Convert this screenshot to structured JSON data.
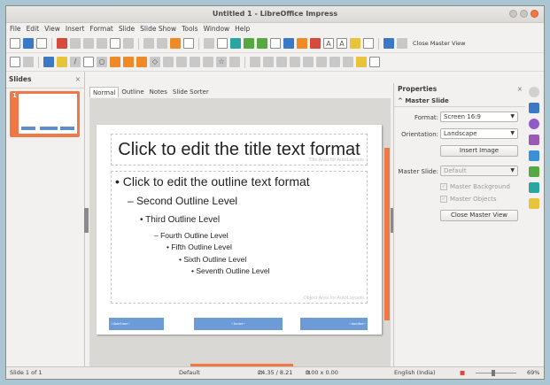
{
  "window": {
    "title": "Untitled 1 - LibreOffice Impress"
  },
  "menu": [
    "File",
    "Edit",
    "View",
    "Insert",
    "Format",
    "Slide",
    "Slide Show",
    "Tools",
    "Window",
    "Help"
  ],
  "toolbar": {
    "close_master_view": "Close Master View"
  },
  "slides_pane": {
    "title": "Slides",
    "close": "×",
    "thumb_number": "1"
  },
  "tabs": [
    "Normal",
    "Outline",
    "Notes",
    "Slide Sorter"
  ],
  "slide": {
    "title": "Click to edit the title text format",
    "title_area_label": "Title Area for AutoLayouts",
    "outline": [
      "Click to edit the outline text format",
      "Second Outline Level",
      "Third Outline Level",
      "Fourth Outline Level",
      "Fifth Outline Level",
      "Sixth Outline Level",
      "Seventh Outline Level"
    ],
    "object_area_label": "Object Area for AutoLayouts",
    "footer": {
      "date": "<date/time>",
      "footer": "<footer>",
      "number": "<number>"
    }
  },
  "properties": {
    "title": "Properties",
    "close": "×",
    "section": "Master Slide",
    "format_label": "Format:",
    "format_value": "Screen 16:9",
    "orientation_label": "Orientation:",
    "orientation_value": "Landscape",
    "insert_image": "Insert Image",
    "master_slide_label": "Master Slide:",
    "master_slide_value": "Default",
    "master_background": "Master Background",
    "master_objects": "Master Objects",
    "close_master_view": "Close Master View"
  },
  "status": {
    "slide": "Slide 1 of 1",
    "master": "Default",
    "position": "24.35 / 8.21",
    "size": "0.00 x 0.00",
    "language": "English (India)",
    "zoom": "69%"
  },
  "colors": {
    "accent": "#f07746",
    "footer_box": "#6c9bd8",
    "desktop": "#a9c6d2"
  }
}
